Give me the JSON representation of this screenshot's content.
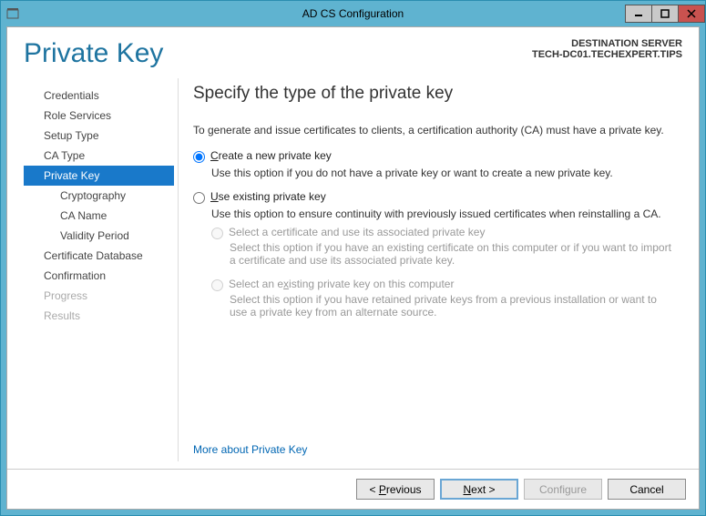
{
  "window": {
    "title": "AD CS Configuration"
  },
  "header": {
    "page_title": "Private Key",
    "dest_label": "DESTINATION SERVER",
    "dest_server": "TECH-DC01.TECHEXPERT.TIPS"
  },
  "sidebar": {
    "items": [
      {
        "label": "Credentials",
        "active": false
      },
      {
        "label": "Role Services",
        "active": false
      },
      {
        "label": "Setup Type",
        "active": false
      },
      {
        "label": "CA Type",
        "active": false
      },
      {
        "label": "Private Key",
        "active": true
      },
      {
        "label": "Cryptography",
        "active": false,
        "child": true
      },
      {
        "label": "CA Name",
        "active": false,
        "child": true
      },
      {
        "label": "Validity Period",
        "active": false,
        "child": true
      },
      {
        "label": "Certificate Database",
        "active": false
      },
      {
        "label": "Confirmation",
        "active": false
      },
      {
        "label": "Progress",
        "active": false,
        "disabled": true
      },
      {
        "label": "Results",
        "active": false,
        "disabled": true
      }
    ]
  },
  "main": {
    "heading": "Specify the type of the private key",
    "intro": "To generate and issue certificates to clients, a certification authority (CA) must have a private key.",
    "opt_create": {
      "label_pre": "C",
      "label_post": "reate a new private key",
      "desc": "Use this option if you do not have a private key or want to create a new private key."
    },
    "opt_existing": {
      "label_pre": "U",
      "label_post": "se existing private key",
      "desc": "Use this option to ensure continuity with previously issued certificates when reinstalling a CA."
    },
    "sub_cert": {
      "label": "Select a certificate and use its associated private key",
      "desc": "Select this option if you have an existing certificate on this computer or if you want to import a certificate and use its associated private key."
    },
    "sub_key": {
      "label_pre": "Select an e",
      "label_u": "x",
      "label_post": "isting private key on this computer",
      "desc": "Select this option if you have retained private keys from a previous installation or want to use a private key from an alternate source."
    },
    "more_link": "More about Private Key"
  },
  "footer": {
    "previous": "< Previous",
    "next": "Next >",
    "configure": "Configure",
    "cancel": "Cancel"
  }
}
